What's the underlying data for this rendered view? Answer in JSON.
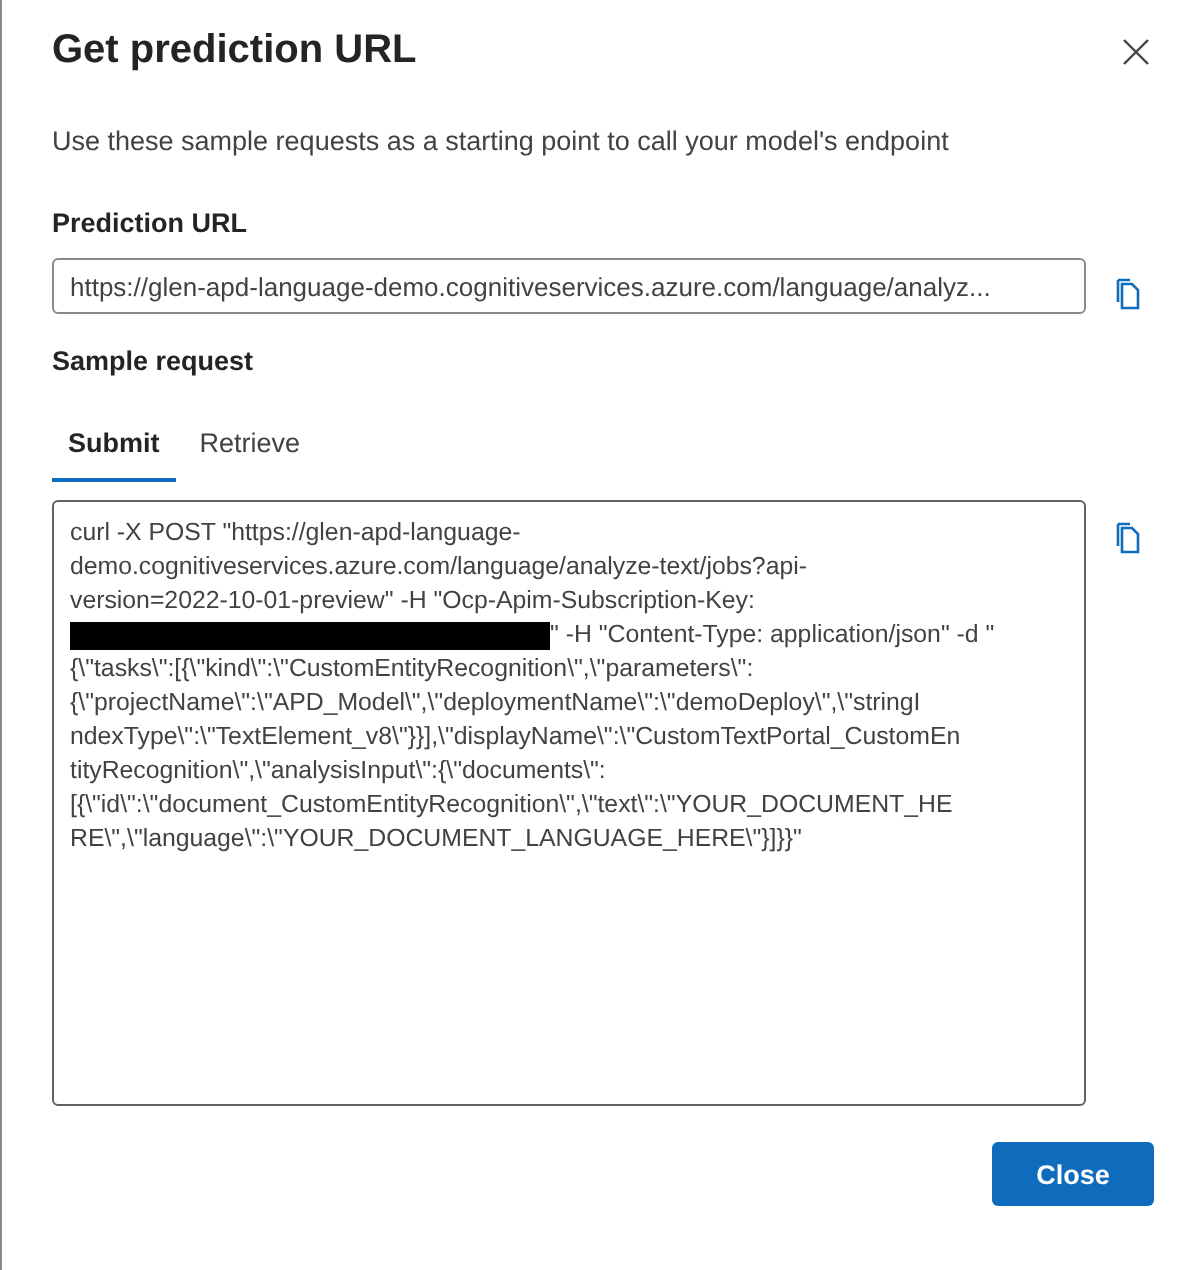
{
  "dialog": {
    "title": "Get prediction URL",
    "description": "Use these sample requests as a starting point to call your model's endpoint"
  },
  "prediction_url": {
    "label": "Prediction URL",
    "value": "https://glen-apd-language-demo.cognitiveservices.azure.com/language/analyz..."
  },
  "sample_request": {
    "label": "Sample request",
    "tabs": [
      {
        "label": "Submit",
        "selected": true
      },
      {
        "label": "Retrieve",
        "selected": false
      }
    ],
    "lines": [
      {
        "text": "curl -X POST \"https://glen-apd-language-",
        "redacted": false
      },
      {
        "text": "demo.cognitiveservices.azure.com/language/analyze-text/jobs?api-",
        "redacted": false
      },
      {
        "text": "version=2022-10-01-preview\" -H \"Ocp-Apim-Subscription-Key:",
        "redacted": false
      },
      {
        "text": "\" -H \"Content-Type: application/json\" -d \"",
        "redacted": true
      },
      {
        "text": "{\\\"tasks\\\":[{\\\"kind\\\":\\\"CustomEntityRecognition\\\",\\\"parameters\\\":",
        "redacted": false
      },
      {
        "text": "{\\\"projectName\\\":\\\"APD_Model\\\",\\\"deploymentName\\\":\\\"demoDeploy\\\",\\\"stringI",
        "redacted": false
      },
      {
        "text": "ndexType\\\":\\\"TextElement_v8\\\"}}],\\\"displayName\\\":\\\"CustomTextPortal_CustomEn",
        "redacted": false
      },
      {
        "text": "tityRecognition\\\",\\\"analysisInput\\\":{\\\"documents\\\":",
        "redacted": false
      },
      {
        "text": "[{\\\"id\\\":\\\"document_CustomEntityRecognition\\\",\\\"text\\\":\\\"YOUR_DOCUMENT_HE",
        "redacted": false
      },
      {
        "text": "RE\\\",\\\"language\\\":\\\"YOUR_DOCUMENT_LANGUAGE_HERE\\\"}]}}\"",
        "redacted": false
      }
    ]
  },
  "buttons": [
    {
      "label": "Close",
      "kind": "primary"
    }
  ]
}
